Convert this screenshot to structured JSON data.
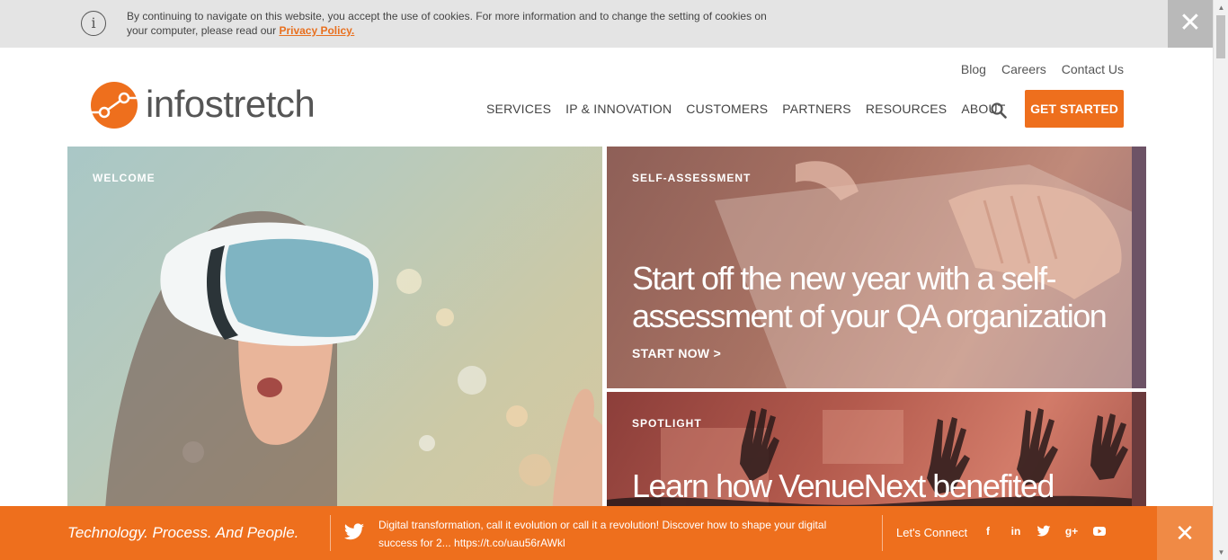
{
  "cookie_bar": {
    "text": "By continuing to navigate on this website, you accept the use of cookies. For more information and to change the setting of cookies on your computer, please read our ",
    "link_label": "Privacy Policy.",
    "close_symbol": "✕"
  },
  "brand": {
    "name": "infostretch",
    "accent_color": "#ee6f1d"
  },
  "top_links": [
    "Blog",
    "Careers",
    "Contact Us"
  ],
  "main_nav": [
    "SERVICES",
    "IP & INNOVATION",
    "CUSTOMERS",
    "PARTNERS",
    "RESOURCES",
    "ABOUT"
  ],
  "cta_button": "GET STARTED",
  "tiles": {
    "welcome": {
      "label": "WELCOME"
    },
    "assessment": {
      "label": "SELF-ASSESSMENT",
      "headline_1": "Start off the new year with a self-",
      "headline_2": "assessment of your QA organization",
      "cta": "START NOW >"
    },
    "spotlight": {
      "label": "SPOTLIGHT",
      "headline": "Learn how VenueNext benefited"
    }
  },
  "footer": {
    "tagline": "Technology. Process. And People.",
    "tweet": "Digital transformation, call it evolution or call it a revolution! Discover how to shape your digital success for 2... https://t.co/uau56rAWkl",
    "connect_label": "Let's Connect",
    "social_icons": [
      "facebook-icon",
      "linkedin-icon",
      "twitter-icon",
      "google-plus-icon",
      "youtube-icon"
    ],
    "close_symbol": "✕"
  }
}
